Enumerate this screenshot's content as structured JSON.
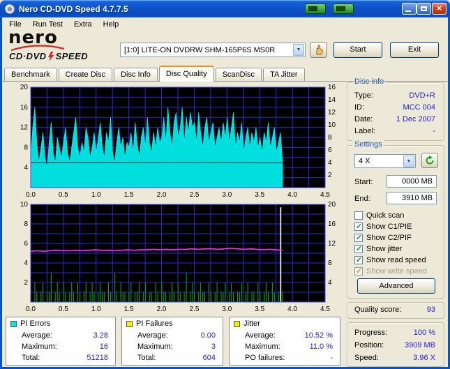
{
  "window": {
    "title": "Nero CD-DVD Speed 4.7.7.5"
  },
  "menu": {
    "items": [
      "File",
      "Run Test",
      "Extra",
      "Help"
    ]
  },
  "logo": {
    "brand": "nero",
    "product_left": "CD·DVD",
    "product_right": "SPEED"
  },
  "header": {
    "drive": "[1:0]  LITE-ON DVDRW SHM-165P6S MS0R",
    "start_button": "Start",
    "exit_button": "Exit"
  },
  "tabs": [
    "Benchmark",
    "Create Disc",
    "Disc Info",
    "Disc Quality",
    "ScanDisc",
    "TA Jitter"
  ],
  "active_tab": "Disc Quality",
  "disc_info": {
    "title": "Disc info",
    "rows": [
      {
        "label": "Type:",
        "value": "DVD+R"
      },
      {
        "label": "ID:",
        "value": "MCC 004"
      },
      {
        "label": "Date:",
        "value": "1 Dec 2007"
      },
      {
        "label": "Label:",
        "value": "-"
      }
    ]
  },
  "settings": {
    "title": "Settings",
    "speed": "4 X",
    "start_label": "Start:",
    "start_value": "0000 MB",
    "end_label": "End:",
    "end_value": "3910 MB",
    "checkboxes": [
      {
        "label": "Quick scan",
        "checked": false,
        "disabled": false
      },
      {
        "label": "Show C1/PIE",
        "checked": true,
        "disabled": false
      },
      {
        "label": "Show C2/PIF",
        "checked": true,
        "disabled": false
      },
      {
        "label": "Show jitter",
        "checked": true,
        "disabled": false
      },
      {
        "label": "Show read speed",
        "checked": true,
        "disabled": false
      },
      {
        "label": "Show write speed",
        "checked": true,
        "disabled": true
      }
    ],
    "advanced_button": "Advanced"
  },
  "quality": {
    "label": "Quality score:",
    "value": "93"
  },
  "progress": {
    "rows": [
      {
        "label": "Progress:",
        "value": "100 %"
      },
      {
        "label": "Position:",
        "value": "3909 MB"
      },
      {
        "label": "Speed:",
        "value": "3.96 X"
      }
    ]
  },
  "stats": {
    "pi_errors": {
      "title": "PI Errors",
      "color": "#00E6E6",
      "rows": [
        [
          "Average:",
          "3.28"
        ],
        [
          "Maximum:",
          "16"
        ],
        [
          "Total:",
          "51218"
        ]
      ]
    },
    "pi_failures": {
      "title": "PI Failures",
      "color": "#F0F000",
      "rows": [
        [
          "Average:",
          "0.00"
        ],
        [
          "Maximum:",
          "3"
        ],
        [
          "Total:",
          "604"
        ]
      ]
    },
    "jitter": {
      "title": "Jitter",
      "color": "#F0F000",
      "rows": [
        [
          "Average:",
          "10.52 %"
        ],
        [
          "Maximum:",
          "11.0 %"
        ],
        [
          "PO failures:",
          "-"
        ]
      ]
    }
  },
  "chart_data": [
    {
      "type": "area",
      "name": "PI Errors and read speed",
      "x_axis": {
        "range": [
          0,
          4.5
        ],
        "ticks": [
          "0.0",
          "0.5",
          "1.0",
          "1.5",
          "2.0",
          "2.5",
          "3.0",
          "3.5",
          "4.0",
          "4.5"
        ]
      },
      "left_axis": {
        "range": [
          0,
          20
        ],
        "ticks": [
          4,
          8,
          12,
          16,
          20
        ],
        "grid_step": 2
      },
      "right_axis": {
        "range": [
          0,
          16
        ],
        "ticks": [
          2,
          4,
          6,
          8,
          10,
          12,
          14,
          16
        ]
      },
      "series": [
        {
          "name": "PI Errors",
          "type": "area",
          "axis": "left",
          "color": "#00DEDE",
          "x_end": 3.85,
          "values": [
            6,
            12,
            16,
            9,
            5,
            8,
            11,
            6,
            4,
            9,
            13,
            7,
            5,
            10,
            8,
            6,
            9,
            12,
            7,
            5,
            8,
            11,
            14,
            8,
            6,
            9,
            7,
            12,
            10,
            6,
            8,
            11,
            7,
            10,
            13,
            8,
            6,
            11,
            9,
            14,
            7,
            5,
            9,
            12,
            8,
            10,
            6,
            9,
            8,
            11,
            7,
            13,
            9,
            6,
            10,
            12,
            8,
            14,
            9,
            7,
            11,
            8,
            12,
            9,
            10,
            14,
            9,
            16,
            11,
            8,
            13,
            15,
            10,
            12,
            16,
            9,
            14,
            11,
            15,
            12,
            13,
            9,
            15,
            11,
            8,
            12,
            14,
            9,
            11,
            13,
            8,
            10,
            12,
            9,
            13,
            10,
            14,
            9,
            12,
            15,
            8,
            11,
            9,
            13,
            7,
            10,
            12,
            8,
            11,
            9,
            12,
            8,
            10,
            7,
            11,
            9,
            13,
            8,
            10,
            12,
            7,
            9,
            11,
            5
          ]
        },
        {
          "name": "Read speed",
          "type": "line",
          "axis": "right",
          "color": "#056D6D",
          "points": [
            [
              0,
              4.02
            ],
            [
              3.85,
              3.96
            ]
          ]
        }
      ]
    },
    {
      "type": "bar",
      "name": "PI Failures and jitter",
      "x_axis": {
        "range": [
          0,
          4.5
        ],
        "ticks": [
          "0.0",
          "0.5",
          "1.0",
          "1.5",
          "2.0",
          "2.5",
          "3.0",
          "3.5",
          "4.0",
          "4.5"
        ]
      },
      "left_axis": {
        "range": [
          0,
          10
        ],
        "ticks": [
          2,
          4,
          6,
          8,
          10
        ],
        "grid_step": 1
      },
      "right_axis": {
        "range": [
          0,
          20
        ],
        "ticks": [
          4,
          8,
          12,
          16,
          20
        ]
      },
      "series": [
        {
          "name": "PI Failures",
          "type": "bars",
          "axis": "left",
          "color": "#00B400",
          "x_end": 3.85,
          "values": [
            1,
            0,
            2,
            1,
            0,
            1,
            2,
            0,
            1,
            1,
            3,
            0,
            1,
            2,
            1,
            0,
            2,
            1,
            0,
            1,
            2,
            1,
            0,
            2,
            1,
            0,
            1,
            2,
            0,
            1,
            2,
            1,
            0,
            1,
            2,
            1,
            1,
            0,
            2,
            1,
            0,
            3,
            1,
            0,
            2,
            1,
            1,
            0,
            1,
            2,
            0,
            1,
            1,
            2,
            0,
            1,
            2,
            0,
            1,
            1,
            0,
            2,
            1,
            0,
            2,
            1,
            1,
            0,
            1,
            2,
            1,
            0,
            2,
            1,
            0,
            1,
            3,
            0,
            1,
            2,
            1,
            0,
            1,
            2,
            1,
            1,
            0,
            2,
            1,
            0,
            1,
            2,
            0,
            1,
            1,
            2,
            0,
            1,
            2,
            1,
            0,
            1,
            1,
            2,
            0,
            1,
            2,
            0,
            1,
            1,
            0,
            2,
            1,
            0,
            1,
            2,
            1,
            0,
            2,
            1,
            0,
            1,
            0,
            1
          ]
        },
        {
          "name": "Scan end marker",
          "type": "spike",
          "axis": "left",
          "color": "#D9D9D9",
          "x": 3.82,
          "value": 9.7
        },
        {
          "name": "Jitter",
          "type": "line",
          "axis": "right",
          "color": "#FF2BFF",
          "x_end": 3.85,
          "values": [
            10.4,
            10.5,
            10.4,
            10.5,
            10.6,
            10.5,
            10.5,
            10.6,
            10.5,
            10.6,
            10.7,
            10.6,
            10.6,
            10.5,
            10.6,
            10.7,
            10.6,
            10.7,
            10.7,
            10.8,
            10.7,
            10.8,
            10.7,
            10.8,
            10.8,
            10.9,
            10.8,
            10.9,
            10.9,
            10.8,
            10.9,
            11.0,
            10.9,
            10.8,
            10.9,
            10.8,
            10.7,
            10.8,
            10.7,
            10.6
          ]
        }
      ]
    }
  ]
}
